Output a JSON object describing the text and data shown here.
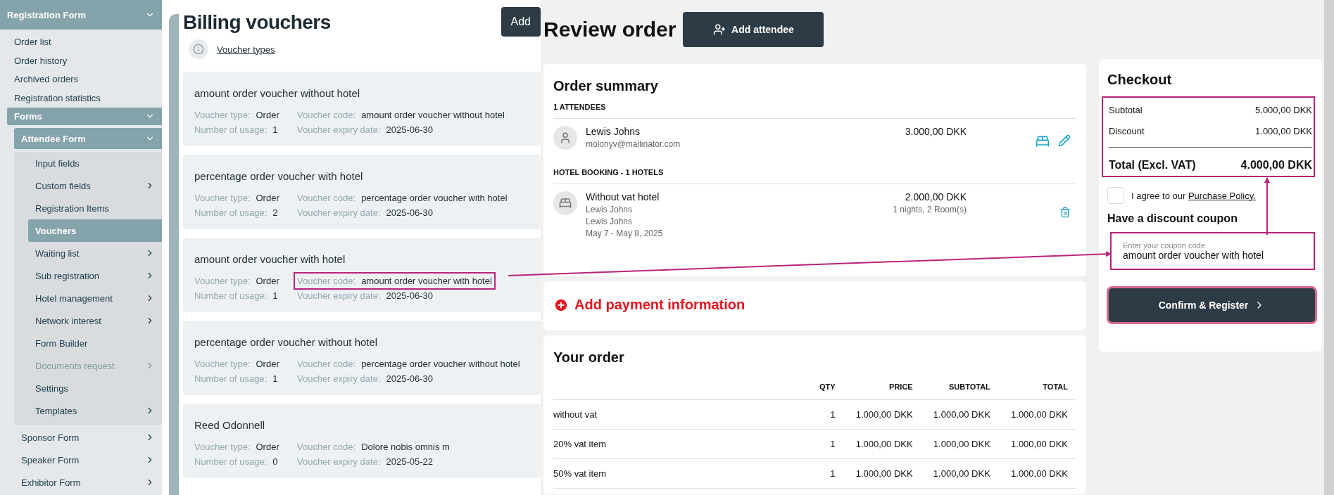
{
  "sidebar": {
    "header": {
      "label": "Registration Form",
      "expanded": true
    },
    "items": [
      {
        "label": "Order list",
        "kind": "link",
        "selected": false,
        "disabled": false
      },
      {
        "label": "Order history",
        "kind": "link",
        "selected": false,
        "disabled": false
      },
      {
        "label": "Archived orders",
        "kind": "link",
        "selected": false,
        "disabled": false
      },
      {
        "label": "Registration statistics",
        "kind": "link",
        "selected": false,
        "disabled": false
      },
      {
        "label": "Forms",
        "kind": "group",
        "expanded": true,
        "selected": false,
        "disabled": false,
        "children": [
          {
            "label": "Attendee Form",
            "kind": "group",
            "expanded": true,
            "selected": false,
            "disabled": false,
            "children": [
              {
                "label": "Input fields",
                "kind": "link",
                "selected": false,
                "disabled": false
              },
              {
                "label": "Custom fields",
                "kind": "group",
                "expanded": false,
                "selected": false,
                "disabled": false
              },
              {
                "label": "Registration Items",
                "kind": "link",
                "selected": false,
                "disabled": false
              },
              {
                "label": "Vouchers",
                "kind": "link",
                "selected": true,
                "disabled": false
              },
              {
                "label": "Waiting list",
                "kind": "group",
                "expanded": false,
                "selected": false,
                "disabled": false
              },
              {
                "label": "Sub registration",
                "kind": "group",
                "expanded": false,
                "selected": false,
                "disabled": false
              },
              {
                "label": "Hotel management",
                "kind": "group",
                "expanded": false,
                "selected": false,
                "disabled": false
              },
              {
                "label": "Network interest",
                "kind": "group",
                "expanded": false,
                "selected": false,
                "disabled": false
              },
              {
                "label": "Form Builder",
                "kind": "link",
                "selected": false,
                "disabled": false
              },
              {
                "label": "Documents request",
                "kind": "group",
                "expanded": false,
                "selected": false,
                "disabled": true
              },
              {
                "label": "Settings",
                "kind": "link",
                "selected": false,
                "disabled": false
              },
              {
                "label": "Templates",
                "kind": "group",
                "expanded": false,
                "selected": false,
                "disabled": false
              }
            ]
          },
          {
            "label": "Sponsor Form",
            "kind": "group",
            "expanded": false,
            "selected": false,
            "disabled": false
          },
          {
            "label": "Speaker Form",
            "kind": "group",
            "expanded": false,
            "selected": false,
            "disabled": false
          },
          {
            "label": "Exhibitor Form",
            "kind": "group",
            "expanded": false,
            "selected": false,
            "disabled": false
          }
        ]
      }
    ]
  },
  "vouchers": {
    "title": "Billing vouchers",
    "add_button": "Add",
    "help_link": "Voucher types",
    "items": [
      {
        "name": "amount order voucher without hotel",
        "fields": [
          {
            "label": "Voucher type:",
            "value": "Order",
            "highlighted": false
          },
          {
            "label": "Voucher code:",
            "value": "amount order voucher without hotel",
            "highlighted": false
          },
          {
            "label": "Number of usage:",
            "value": "1",
            "highlighted": false
          },
          {
            "label": "Voucher expiry date:",
            "value": "2025-06-30",
            "highlighted": false
          }
        ]
      },
      {
        "name": "percentage order voucher with hotel",
        "fields": [
          {
            "label": "Voucher type:",
            "value": "Order",
            "highlighted": false
          },
          {
            "label": "Voucher code:",
            "value": "percentage order voucher with hotel",
            "highlighted": false
          },
          {
            "label": "Number of usage:",
            "value": "2",
            "highlighted": false
          },
          {
            "label": "Voucher expiry date:",
            "value": "2025-06-30",
            "highlighted": false
          }
        ]
      },
      {
        "name": "amount order voucher with hotel",
        "fields": [
          {
            "label": "Voucher type:",
            "value": "Order",
            "highlighted": false
          },
          {
            "label": "Voucher code:",
            "value": "amount order voucher with hotel",
            "highlighted": true
          },
          {
            "label": "Number of usage:",
            "value": "1",
            "highlighted": false
          },
          {
            "label": "Voucher expiry date:",
            "value": "2025-06-30",
            "highlighted": false
          }
        ]
      },
      {
        "name": "percentage order voucher without hotel",
        "fields": [
          {
            "label": "Voucher type:",
            "value": "Order",
            "highlighted": false
          },
          {
            "label": "Voucher code:",
            "value": "percentage order voucher without hotel",
            "highlighted": false
          },
          {
            "label": "Number of usage:",
            "value": "1",
            "highlighted": false
          },
          {
            "label": "Voucher expiry date:",
            "value": "2025-06-30",
            "highlighted": false
          }
        ]
      },
      {
        "name": "Reed Odonnell",
        "fields": [
          {
            "label": "Voucher type:",
            "value": "Order",
            "highlighted": false
          },
          {
            "label": "Voucher code:",
            "value": "Dolore nobis omnis m",
            "highlighted": false
          },
          {
            "label": "Number of usage:",
            "value": "0",
            "highlighted": false
          },
          {
            "label": "Voucher expiry date:",
            "value": "2025-05-22",
            "highlighted": false
          }
        ]
      }
    ]
  },
  "review": {
    "title": "Review order",
    "add_attendee": "Add attendee",
    "order_summary": {
      "title": "Order summary",
      "attendees_heading": "1 ATTENDEES",
      "attendees": [
        {
          "name": "Lewis Johns",
          "email": "molonyv@mailinator.com",
          "price": "3.000,00 DKK"
        }
      ],
      "hotel_heading": "HOTEL BOOKING - 1 HOTELS",
      "hotels": [
        {
          "name": "Without vat hotel",
          "lines": [
            "Lewis Johns",
            "Lewis Johns",
            "May 7 - May 8, 2025"
          ],
          "price": "2.000,00 DKK",
          "detail": "1 nights, 2 Room(s)"
        }
      ]
    },
    "payment": {
      "label": "Add payment information"
    },
    "your_order": {
      "title": "Your order",
      "columns": [
        "QTY",
        "PRICE",
        "SUBTOTAL",
        "TOTAL"
      ],
      "rows": [
        {
          "item": "without vat",
          "cells": [
            "1",
            "1.000,00 DKK",
            "1.000,00 DKK",
            "1.000,00 DKK"
          ]
        },
        {
          "item": "20% vat item",
          "cells": [
            "1",
            "1.000,00 DKK",
            "1.000,00 DKK",
            "1.000,00 DKK"
          ]
        },
        {
          "item": "50% vat item",
          "cells": [
            "1",
            "1.000,00 DKK",
            "1.000,00 DKK",
            "1.000,00 DKK"
          ]
        }
      ]
    }
  },
  "checkout": {
    "title": "Checkout",
    "highlighted": true,
    "lines": [
      {
        "label": "Subtotal",
        "value": "5.000,00 DKK"
      },
      {
        "label": "Discount",
        "value": "1.000,00 DKK"
      }
    ],
    "total": {
      "label": "Total (Excl. VAT)",
      "value": "4.000,00 DKK"
    },
    "agree": {
      "checked": false,
      "text": "I agree to our",
      "link": "Purchase Policy."
    },
    "coupon_heading": "Have a discount coupon",
    "coupon": {
      "label": "Enter your coupon code",
      "value": "amount order voucher with hotel",
      "highlighted": true
    },
    "confirm": {
      "label": "Confirm & Register",
      "focused": true
    }
  }
}
